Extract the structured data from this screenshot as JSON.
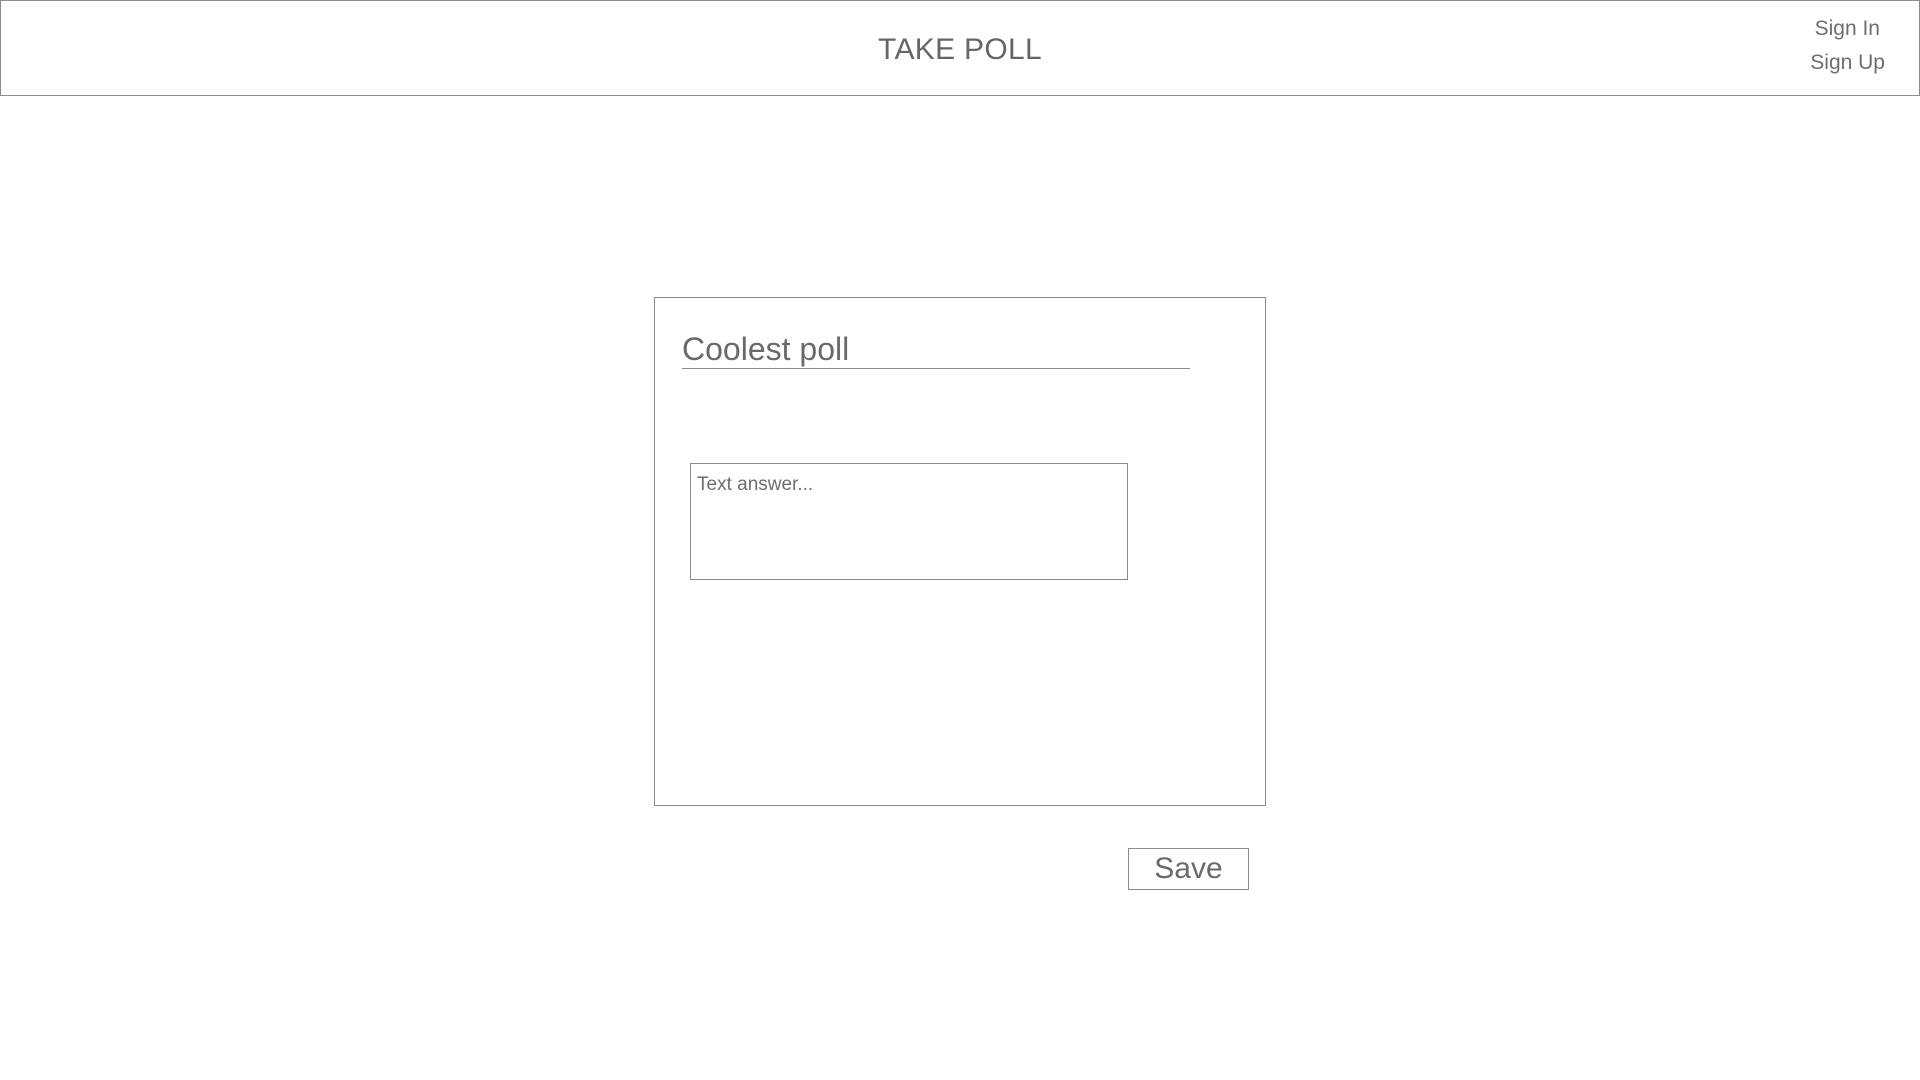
{
  "header": {
    "title": "TAKE POLL",
    "sign_in": "Sign In",
    "sign_up": "Sign Up"
  },
  "poll": {
    "title": "Coolest poll",
    "answer_placeholder": "Text answer..."
  },
  "actions": {
    "save_label": "Save"
  }
}
